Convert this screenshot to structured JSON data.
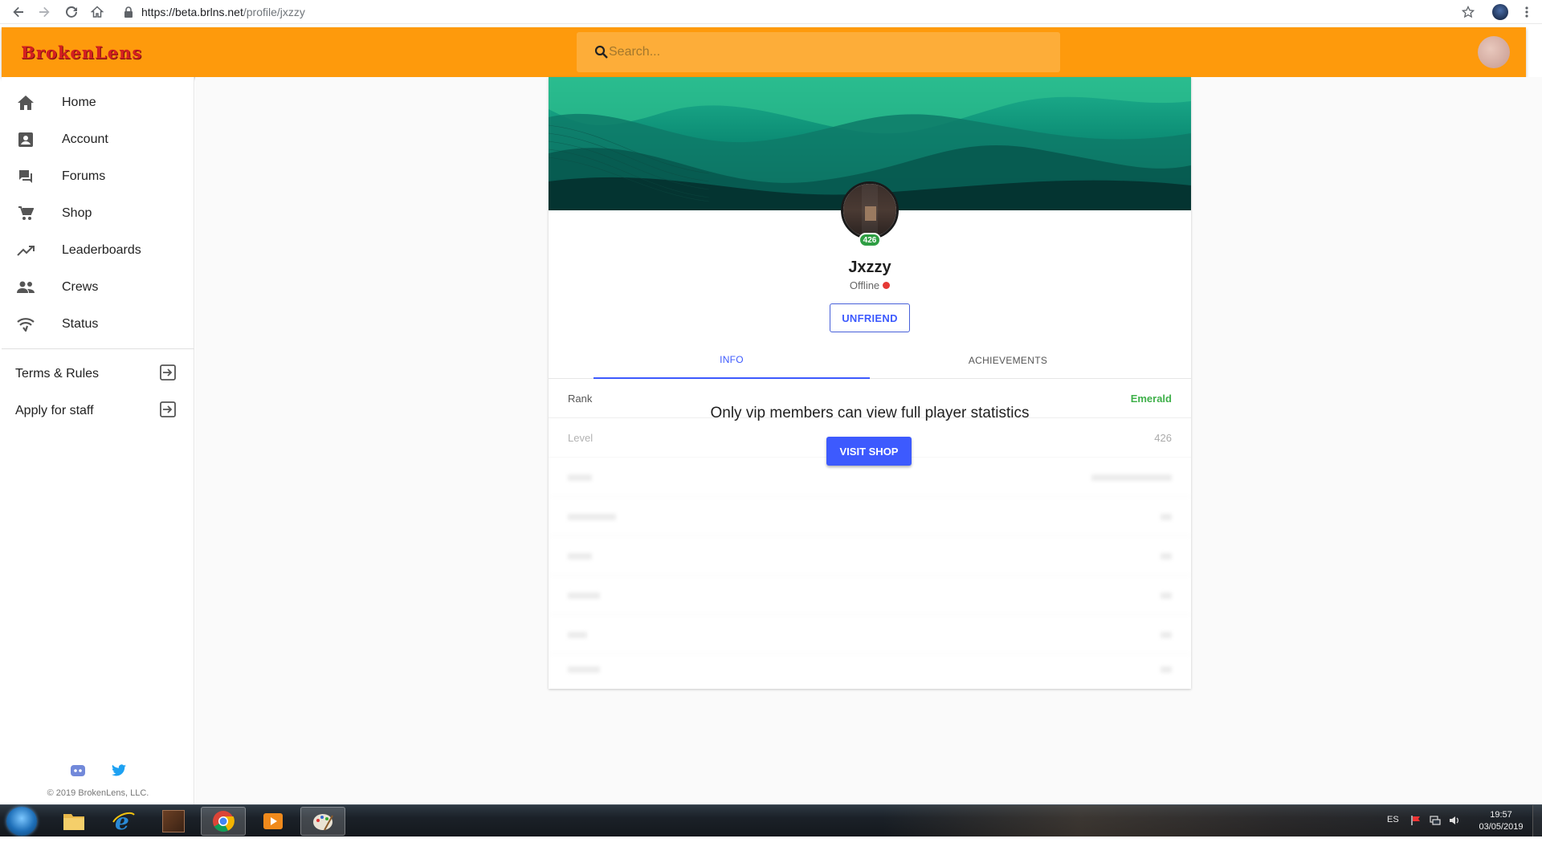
{
  "browser": {
    "url_host": "https://beta.brlns.net",
    "url_path": "/profile/jxzzy"
  },
  "app": {
    "brand": "BrokenLens",
    "search_placeholder": "Search..."
  },
  "sidebar": {
    "items": [
      {
        "label": "Home",
        "icon": "home-icon"
      },
      {
        "label": "Account",
        "icon": "account-box-icon"
      },
      {
        "label": "Forums",
        "icon": "forum-icon"
      },
      {
        "label": "Shop",
        "icon": "cart-icon"
      },
      {
        "label": "Leaderboards",
        "icon": "trending-up-icon"
      },
      {
        "label": "Crews",
        "icon": "group-icon"
      },
      {
        "label": "Status",
        "icon": "signal-icon"
      }
    ],
    "links": [
      {
        "label": "Terms & Rules",
        "icon": "exit-to-app-icon"
      },
      {
        "label": "Apply for staff",
        "icon": "exit-to-app-icon"
      }
    ],
    "copyright": "© 2019 BrokenLens, LLC."
  },
  "profile": {
    "username": "Jxzzy",
    "status": "Offline",
    "level_badge": "426",
    "unfriend_label": "UNFRIEND",
    "tabs": [
      "INFO",
      "ACHIEVEMENTS"
    ],
    "stats": [
      {
        "key": "Rank",
        "value": "Emerald"
      },
      {
        "key": "Level",
        "value": "426"
      }
    ],
    "vip_message": "Only vip members can view full player statistics",
    "visit_shop_label": "VISIT SHOP"
  },
  "taskbar": {
    "language": "ES",
    "time": "19:57",
    "date": "03/05/2019"
  },
  "colors": {
    "brand_orange": "#fe9a0c",
    "accent_blue": "#3d5afe",
    "rank_green": "#3fb04a",
    "offline_red": "#e53935"
  }
}
